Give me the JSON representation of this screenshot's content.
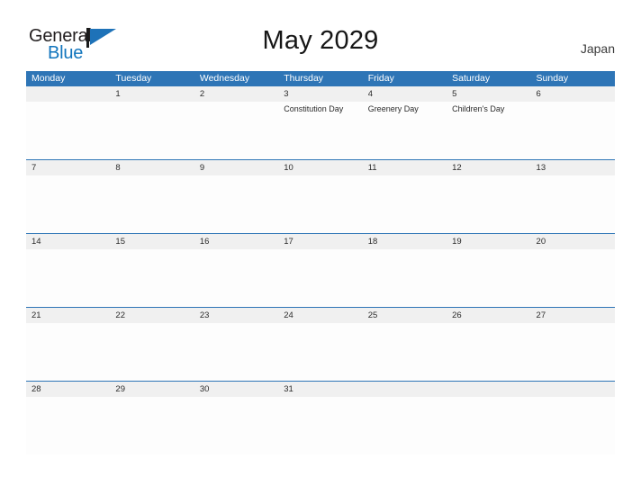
{
  "header": {
    "logo": {
      "word_general": "General",
      "word_blue": "Blue",
      "mark_name": "general-blue-flag-logo"
    },
    "title": "May 2029",
    "country": "Japan"
  },
  "calendar": {
    "weekdays": [
      "Monday",
      "Tuesday",
      "Wednesday",
      "Thursday",
      "Friday",
      "Saturday",
      "Sunday"
    ],
    "weeks": [
      [
        {
          "date": "",
          "event": ""
        },
        {
          "date": "1",
          "event": ""
        },
        {
          "date": "2",
          "event": ""
        },
        {
          "date": "3",
          "event": "Constitution Day"
        },
        {
          "date": "4",
          "event": "Greenery Day"
        },
        {
          "date": "5",
          "event": "Children's Day"
        },
        {
          "date": "6",
          "event": ""
        }
      ],
      [
        {
          "date": "7",
          "event": ""
        },
        {
          "date": "8",
          "event": ""
        },
        {
          "date": "9",
          "event": ""
        },
        {
          "date": "10",
          "event": ""
        },
        {
          "date": "11",
          "event": ""
        },
        {
          "date": "12",
          "event": ""
        },
        {
          "date": "13",
          "event": ""
        }
      ],
      [
        {
          "date": "14",
          "event": ""
        },
        {
          "date": "15",
          "event": ""
        },
        {
          "date": "16",
          "event": ""
        },
        {
          "date": "17",
          "event": ""
        },
        {
          "date": "18",
          "event": ""
        },
        {
          "date": "19",
          "event": ""
        },
        {
          "date": "20",
          "event": ""
        }
      ],
      [
        {
          "date": "21",
          "event": ""
        },
        {
          "date": "22",
          "event": ""
        },
        {
          "date": "23",
          "event": ""
        },
        {
          "date": "24",
          "event": ""
        },
        {
          "date": "25",
          "event": ""
        },
        {
          "date": "26",
          "event": ""
        },
        {
          "date": "27",
          "event": ""
        }
      ],
      [
        {
          "date": "28",
          "event": ""
        },
        {
          "date": "29",
          "event": ""
        },
        {
          "date": "30",
          "event": ""
        },
        {
          "date": "31",
          "event": ""
        },
        {
          "date": "",
          "event": ""
        },
        {
          "date": "",
          "event": ""
        },
        {
          "date": "",
          "event": ""
        }
      ]
    ]
  },
  "colors": {
    "header_blue": "#2e75b6",
    "logo_blue": "#1175bd",
    "band_gray": "#f0f0f0",
    "text_dark": "#2b2b2b"
  }
}
